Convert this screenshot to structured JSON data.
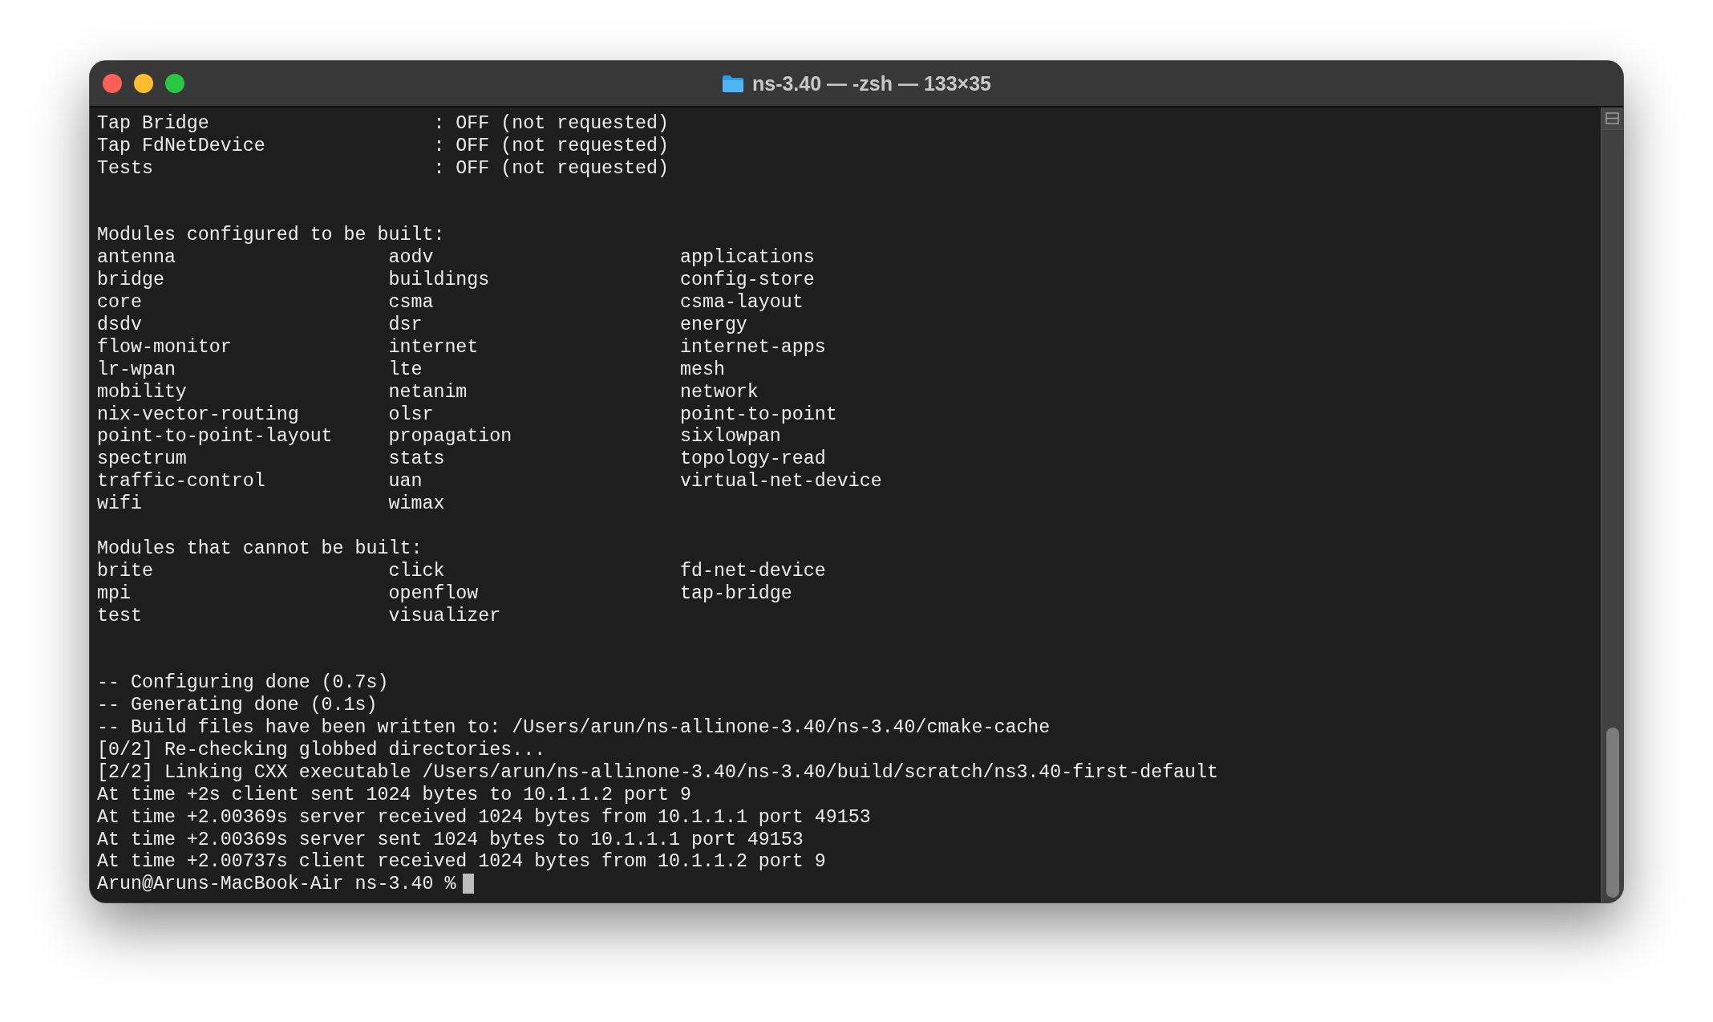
{
  "window": {
    "title": "ns-3.40 — -zsh — 133×35"
  },
  "lines": [
    {
      "kind": "setting",
      "label": "Tap Bridge",
      "value": ": OFF (not requested)"
    },
    {
      "kind": "setting",
      "label": "Tap FdNetDevice",
      "value": ": OFF (not requested)"
    },
    {
      "kind": "setting",
      "label": "Tests",
      "value": ": OFF (not requested)"
    },
    {
      "kind": "blank"
    },
    {
      "kind": "blank"
    },
    {
      "kind": "text",
      "text": "Modules configured to be built:"
    },
    {
      "kind": "columns",
      "cells": [
        "antenna",
        "aodv",
        "applications"
      ]
    },
    {
      "kind": "columns",
      "cells": [
        "bridge",
        "buildings",
        "config-store"
      ]
    },
    {
      "kind": "columns",
      "cells": [
        "core",
        "csma",
        "csma-layout"
      ]
    },
    {
      "kind": "columns",
      "cells": [
        "dsdv",
        "dsr",
        "energy"
      ]
    },
    {
      "kind": "columns",
      "cells": [
        "flow-monitor",
        "internet",
        "internet-apps"
      ]
    },
    {
      "kind": "columns",
      "cells": [
        "lr-wpan",
        "lte",
        "mesh"
      ]
    },
    {
      "kind": "columns",
      "cells": [
        "mobility",
        "netanim",
        "network"
      ]
    },
    {
      "kind": "columns",
      "cells": [
        "nix-vector-routing",
        "olsr",
        "point-to-point"
      ]
    },
    {
      "kind": "columns",
      "cells": [
        "point-to-point-layout",
        "propagation",
        "sixlowpan"
      ]
    },
    {
      "kind": "columns",
      "cells": [
        "spectrum",
        "stats",
        "topology-read"
      ]
    },
    {
      "kind": "columns",
      "cells": [
        "traffic-control",
        "uan",
        "virtual-net-device"
      ]
    },
    {
      "kind": "columns",
      "cells": [
        "wifi",
        "wimax"
      ]
    },
    {
      "kind": "blank"
    },
    {
      "kind": "text",
      "text": "Modules that cannot be built:"
    },
    {
      "kind": "columns",
      "cells": [
        "brite",
        "click",
        "fd-net-device"
      ]
    },
    {
      "kind": "columns",
      "cells": [
        "mpi",
        "openflow",
        "tap-bridge"
      ]
    },
    {
      "kind": "columns",
      "cells": [
        "test",
        "visualizer"
      ]
    },
    {
      "kind": "blank"
    },
    {
      "kind": "blank"
    },
    {
      "kind": "text",
      "text": "-- Configuring done (0.7s)"
    },
    {
      "kind": "text",
      "text": "-- Generating done (0.1s)"
    },
    {
      "kind": "text",
      "text": "-- Build files have been written to: /Users/arun/ns-allinone-3.40/ns-3.40/cmake-cache"
    },
    {
      "kind": "text",
      "text": "[0/2] Re-checking globbed directories..."
    },
    {
      "kind": "text",
      "text": "[2/2] Linking CXX executable /Users/arun/ns-allinone-3.40/ns-3.40/build/scratch/ns3.40-first-default"
    },
    {
      "kind": "text",
      "text": "At time +2s client sent 1024 bytes to 10.1.1.2 port 9"
    },
    {
      "kind": "text",
      "text": "At time +2.00369s server received 1024 bytes from 10.1.1.1 port 49153"
    },
    {
      "kind": "text",
      "text": "At time +2.00369s server sent 1024 bytes to 10.1.1.1 port 49153"
    },
    {
      "kind": "text",
      "text": "At time +2.00737s client received 1024 bytes from 10.1.1.2 port 9"
    },
    {
      "kind": "prompt",
      "text": "Arun@Aruns-MacBook-Air ns-3.40 %"
    }
  ]
}
